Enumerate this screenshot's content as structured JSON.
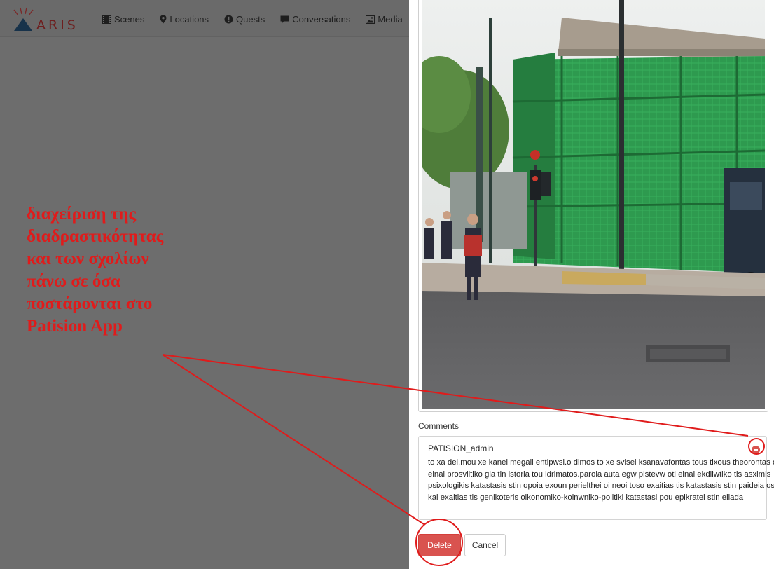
{
  "app": {
    "logo_text": "ARIS",
    "nav": [
      {
        "label": "Scenes",
        "icon": "film-icon"
      },
      {
        "label": "Locations",
        "icon": "map-marker-icon"
      },
      {
        "label": "Quests",
        "icon": "exclamation-circle-icon"
      },
      {
        "label": "Conversations",
        "icon": "comment-icon"
      },
      {
        "label": "Media",
        "icon": "picture-icon"
      }
    ]
  },
  "annotation": {
    "text": "διαχείριση της\nδιαδραστικότητας\nκαι των σχολίων\nπάνω σε όσα\nποστάρονται στο\nPatision App",
    "color": "#e01b1b"
  },
  "modal": {
    "photo_alt": "Street photo of a building covered in green scaffolding netting, traffic light and pedestrians",
    "comments_label": "Comments",
    "comment": {
      "author": "PATISION_admin",
      "text": "to xa dei.mou xe kanei megali entipwsi.o dimos to xe svisei ksanavafontas tous tixous theorontas oti einai prosvlitiko gia tin istoria tou idrimatos.parola auta egw pistevw oti einai ekdilwtiko tis asximis psixologikis katastasis stin opoia exoun perielthei oi neoi toso exaitias tis katastasis stin paideia oso kai exaitias tis genikoteris oikonomiko-koinwniko-politiki katastasi pou epikratei stin ellada"
    },
    "delete_label": "Delete",
    "cancel_label": "Cancel",
    "colors": {
      "danger": "#d9534f",
      "annotation_red": "#e01b1b"
    }
  }
}
